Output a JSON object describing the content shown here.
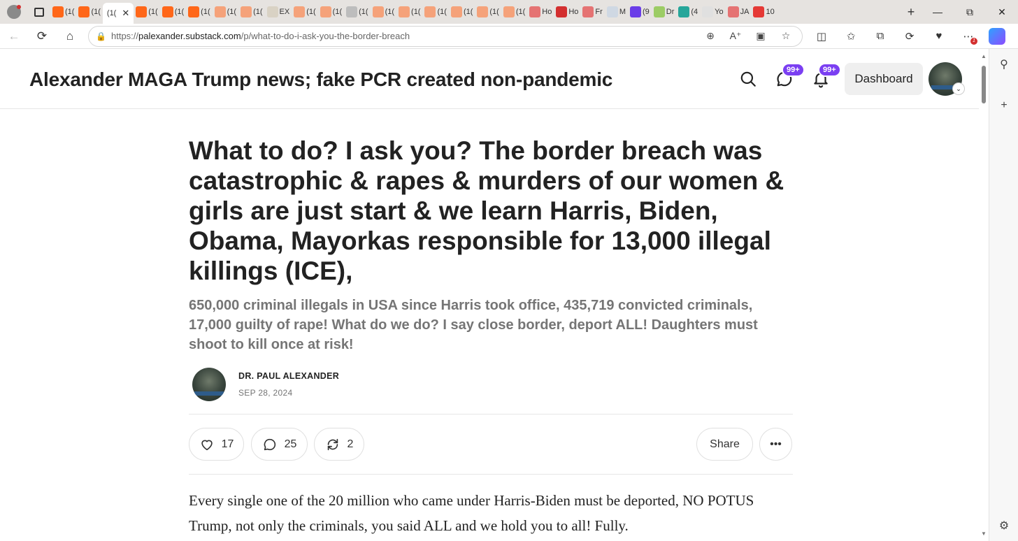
{
  "browser": {
    "tabs": [
      {
        "label": "(1(",
        "favicon": "substack-icon",
        "color": "#ff6719"
      },
      {
        "label": "(1(",
        "favicon": "substack-icon",
        "color": "#ff6719"
      },
      {
        "label": "(1(",
        "favicon": "none",
        "color": "#ffffff",
        "active": true
      },
      {
        "label": "(1(",
        "favicon": "substack-icon",
        "color": "#ff6719"
      },
      {
        "label": "(1(",
        "favicon": "substack-icon",
        "color": "#ff6719"
      },
      {
        "label": "(1(",
        "favicon": "substack-icon",
        "color": "#ff6719"
      },
      {
        "label": "(1(",
        "favicon": "substack-icon",
        "color": "#f5a27a"
      },
      {
        "label": "(1(",
        "favicon": "substack-icon",
        "color": "#f5a27a"
      },
      {
        "label": "EX",
        "favicon": "page-icon",
        "color": "#d9d2c4"
      },
      {
        "label": "(1(",
        "favicon": "substack-icon",
        "color": "#f5a27a"
      },
      {
        "label": "(1(",
        "favicon": "substack-icon",
        "color": "#f5a27a"
      },
      {
        "label": "(1(",
        "favicon": "page-icon",
        "color": "#bdbdbd"
      },
      {
        "label": "(1(",
        "favicon": "substack-icon",
        "color": "#f5a27a"
      },
      {
        "label": "(1(",
        "favicon": "substack-icon",
        "color": "#f5a27a"
      },
      {
        "label": "(1(",
        "favicon": "substack-icon",
        "color": "#f5a27a"
      },
      {
        "label": "(1(",
        "favicon": "substack-icon",
        "color": "#f5a27a"
      },
      {
        "label": "(1(",
        "favicon": "substack-icon",
        "color": "#f5a27a"
      },
      {
        "label": "(1(",
        "favicon": "substack-icon",
        "color": "#f5a27a"
      },
      {
        "label": "Ho",
        "favicon": "red-icon",
        "color": "#e57373"
      },
      {
        "label": "Ho",
        "favicon": "red-icon",
        "color": "#d32f2f"
      },
      {
        "label": "Fr",
        "favicon": "video-icon",
        "color": "#e57373"
      },
      {
        "label": "M",
        "favicon": "search-icon",
        "color": "#cfd8e3"
      },
      {
        "label": "(9",
        "favicon": "mail-icon",
        "color": "#6a3de8"
      },
      {
        "label": "Dr",
        "favicon": "play-icon",
        "color": "#9ccc65"
      },
      {
        "label": "(4",
        "favicon": "g-icon",
        "color": "#26a69a"
      },
      {
        "label": "Yo",
        "favicon": "page-icon",
        "color": "#e0e0e0"
      },
      {
        "label": "JA",
        "favicon": "video-icon",
        "color": "#e57373"
      },
      {
        "label": "10",
        "favicon": "youtube-icon",
        "color": "#e53935"
      }
    ],
    "url_scheme": "https://",
    "url_host": "palexander.substack.com",
    "url_path": "/p/what-to-do-i-ask-you-the-border-breach",
    "extension_badge": "1"
  },
  "site": {
    "title": "Alexander MAGA Trump news; fake PCR created non-pandemic",
    "chat_badge": "99+",
    "notif_badge": "99+",
    "dashboard_label": "Dashboard",
    "accent": "#7b3ff2"
  },
  "post": {
    "headline": "What to do? I ask you? The border breach was catastrophic & rapes & murders of our women & girls are just start & we learn Harris, Biden, Obama, Mayorkas responsible for 13,000 illegal killings (ICE),",
    "subtitle": "650,000 criminal illegals in USA since Harris took office, 435,719 convicted criminals, 17,000 guilty of rape! What do we do? I say close border, deport ALL! Daughters must shoot to kill once at risk!",
    "author": "DR. PAUL ALEXANDER",
    "date": "SEP 28, 2024",
    "likes": "17",
    "comments": "25",
    "restacks": "2",
    "share_label": "Share",
    "body": "Every single one of the 20 million who came under Harris-Biden must be deported, NO POTUS Trump, not only the criminals, you said ALL and we hold you to all! Fully."
  }
}
